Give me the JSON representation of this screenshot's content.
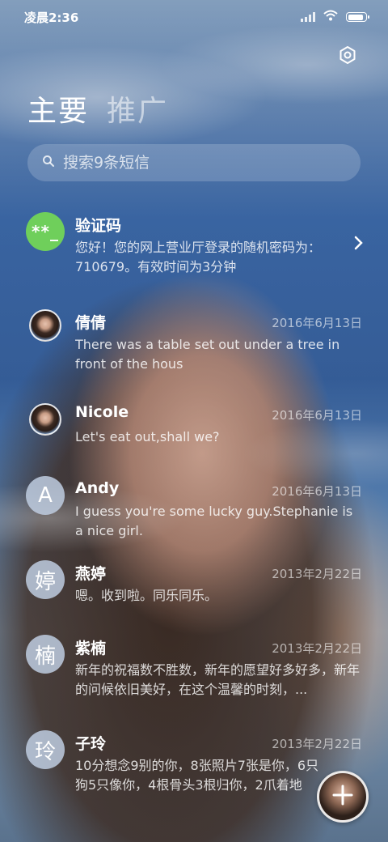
{
  "status": {
    "time": "凌晨2:36",
    "battery_level": 0.9
  },
  "header": {
    "tabs": [
      {
        "label": "主要"
      },
      {
        "label": "推广"
      }
    ]
  },
  "search": {
    "placeholder": "搜索9条短信"
  },
  "conversations": [
    {
      "name": "验证码",
      "date": "",
      "preview": "您好！您的网上营业厅登录的随机密码为：710679。有效时间为3分钟",
      "avatar_text": "**_",
      "avatar_type": "code",
      "has_chevron": true
    },
    {
      "name": "倩倩",
      "date": "2016年6月13日",
      "preview": "There was a table set out under a tree in front of the hous",
      "avatar_type": "photo"
    },
    {
      "name": "Nicole",
      "date": "2016年6月13日",
      "preview": "Let's eat out,shall we?",
      "avatar_type": "photo"
    },
    {
      "name": "Andy",
      "date": "2016年6月13日",
      "preview": "I guess you're some lucky guy.Stephanie is a nice girl.",
      "avatar_text": "A",
      "avatar_type": "letter"
    },
    {
      "name": "燕婷",
      "date": "2013年2月22日",
      "preview": "嗯。收到啦。同乐同乐。",
      "avatar_text": "婷",
      "avatar_type": "letter"
    },
    {
      "name": "紫楠",
      "date": "2013年2月22日",
      "preview": "新年的祝福数不胜数，新年的愿望好多好多，新年的问候依旧美好，在这个温馨的时刻，...",
      "avatar_text": "楠",
      "avatar_type": "letter"
    },
    {
      "name": "子玲",
      "date": "2013年2月22日",
      "preview": "10分想念9别的你，8张照片7张是你，6只狗5只像你，4根骨头3根归你，2爪着地",
      "avatar_text": "玲",
      "avatar_type": "letter"
    }
  ],
  "fab": {
    "label": "+",
    "icon": "plus-icon"
  },
  "icons": {
    "settings": "gear-icon",
    "search": "search-icon",
    "chevron": "chevron-right-icon"
  }
}
